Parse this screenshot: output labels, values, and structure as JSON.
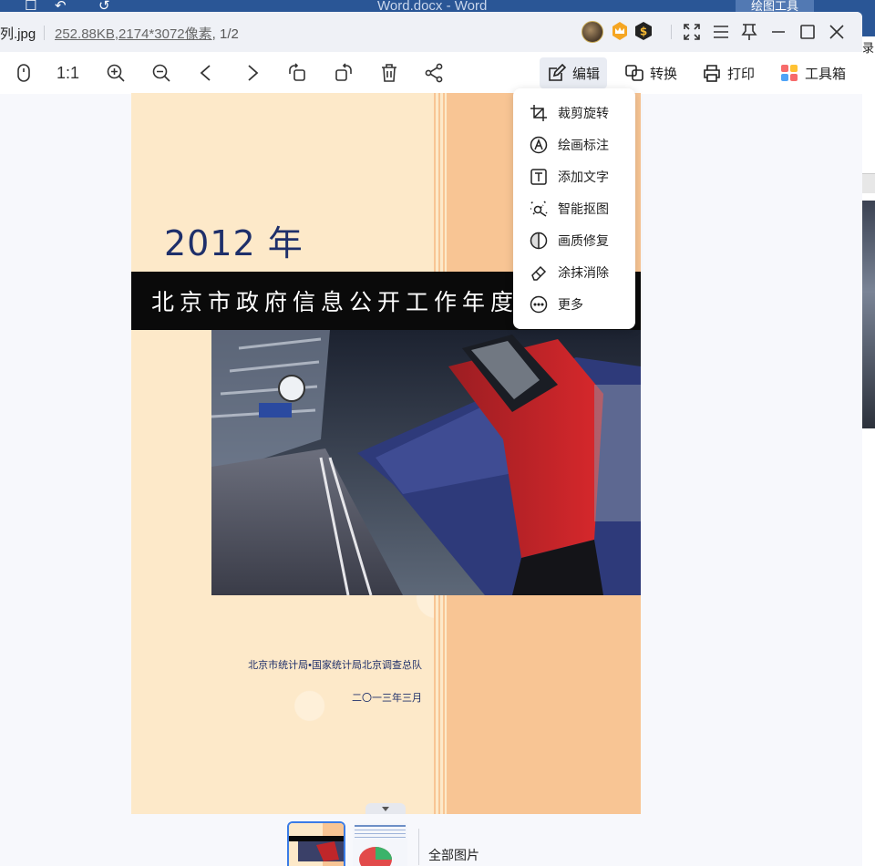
{
  "background_app": {
    "title": "Word.docx - Word",
    "contextual_tab": "绘图工具",
    "right_edge_char": "录"
  },
  "viewer": {
    "file_name": "列.jpg",
    "file_size": "252.88KB",
    "dimensions": ",2174*3072像素",
    "page_info": ", 1/2",
    "title_icons": [
      "avatar-icon",
      "crown-icon",
      "s-badge-icon",
      "fullscreen-icon",
      "menu-icon",
      "pin-icon",
      "minimize-icon",
      "maximize-icon",
      "close-icon"
    ],
    "toolbar": {
      "left_tools": [
        "mouse-icon",
        "actual-size-icon",
        "zoom-in-icon",
        "zoom-out-icon",
        "prev-icon",
        "next-icon",
        "rotate-left-icon",
        "rotate-right-icon",
        "delete-icon",
        "share-icon"
      ],
      "actual_size_label": "1:1",
      "edit_label": "编辑",
      "convert_label": "转换",
      "print_label": "打印",
      "toolbox_label": "工具箱"
    },
    "edit_menu": {
      "items": [
        {
          "label": "裁剪旋转",
          "icon": "crop-icon"
        },
        {
          "label": "绘画标注",
          "icon": "draw-icon"
        },
        {
          "label": "添加文字",
          "icon": "text-icon"
        },
        {
          "label": "智能抠图",
          "icon": "cutout-icon"
        },
        {
          "label": "画质修复",
          "icon": "repair-icon"
        },
        {
          "label": "涂抹消除",
          "icon": "eraser-icon"
        },
        {
          "label": "更多",
          "icon": "more-icon"
        }
      ]
    },
    "document": {
      "year": "2012 年",
      "title": "北京市政府信息公开工作年度报告",
      "organization": "北京市统计局•国家统计局北京调查总队",
      "date": "二〇一三年三月"
    },
    "thumbnails": {
      "all_pictures_label": "全部图片",
      "count": 2,
      "selected_index": 0
    },
    "colors": {
      "accent": "#3b7ce6",
      "doc_background": "#fde9c9",
      "doc_band": "#f8c594",
      "title_text": "#1e2f6a"
    }
  }
}
